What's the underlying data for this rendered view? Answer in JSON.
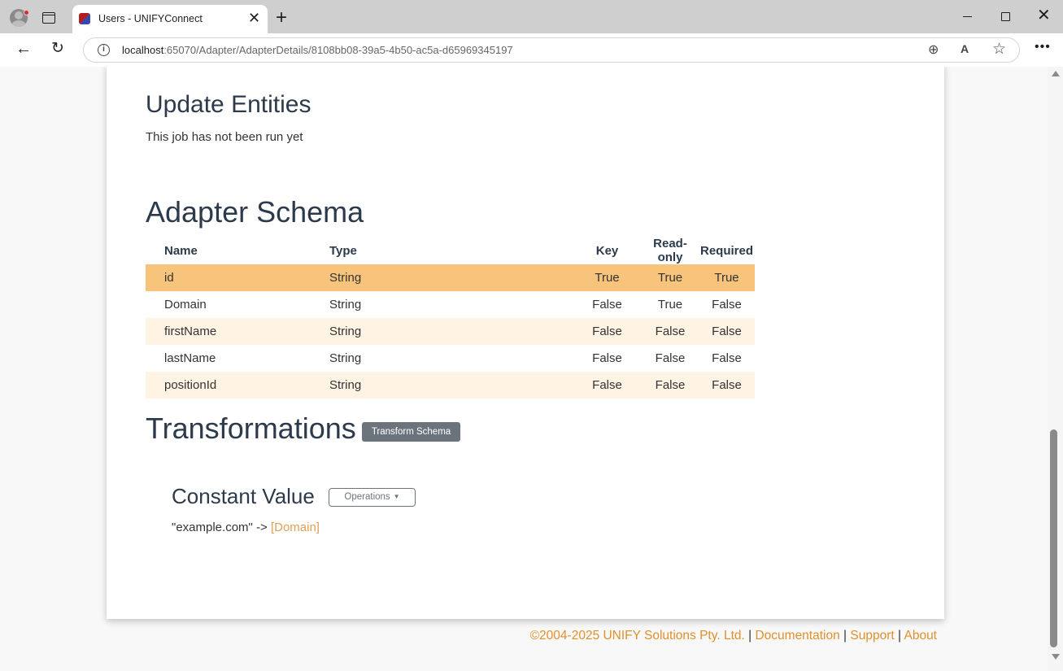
{
  "browser": {
    "tab_title": "Users - UNIFYConnect",
    "url_host": "localhost",
    "url_path": ":65070/Adapter/AdapterDetails/8108bb08-39a5-4b50-ac5a-d65969345197"
  },
  "update": {
    "heading": "Update Entities",
    "status": "This job has not been run yet"
  },
  "schema": {
    "heading": "Adapter Schema",
    "columns": [
      "Name",
      "Type",
      "Key",
      "Read-only",
      "Required"
    ],
    "rows": [
      {
        "name": "id",
        "type": "String",
        "key": "True",
        "readonly": "True",
        "required": "True"
      },
      {
        "name": "Domain",
        "type": "String",
        "key": "False",
        "readonly": "True",
        "required": "False"
      },
      {
        "name": "firstName",
        "type": "String",
        "key": "False",
        "readonly": "False",
        "required": "False"
      },
      {
        "name": "lastName",
        "type": "String",
        "key": "False",
        "readonly": "False",
        "required": "False"
      },
      {
        "name": "positionId",
        "type": "String",
        "key": "False",
        "readonly": "False",
        "required": "False"
      }
    ],
    "highlight_color": "#f8c37a",
    "stripe_color": "#fff3e3"
  },
  "transformations": {
    "heading": "Transformations",
    "transform_button": "Transform Schema",
    "item": {
      "heading": "Constant Value",
      "operations_button": "Operations",
      "source": "\"example.com\" ->",
      "target": "[Domain]"
    }
  },
  "footer": {
    "copyright": "©2004-2025 UNIFY Solutions Pty. Ltd.",
    "documentation": "Documentation",
    "support": "Support",
    "about": "About",
    "separator": "|",
    "link_color": "#e0902d"
  }
}
